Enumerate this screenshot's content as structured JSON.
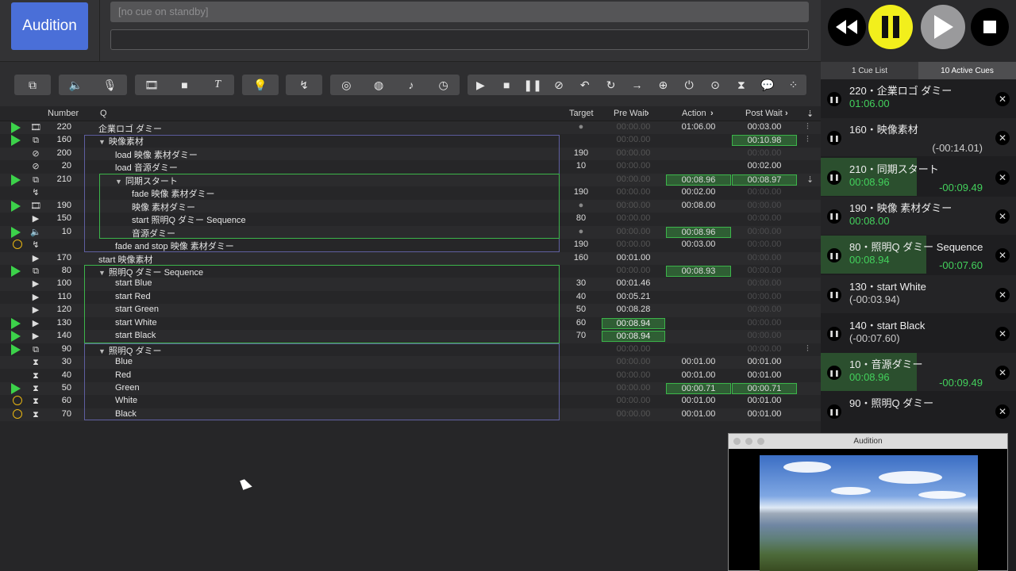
{
  "header": {
    "audition_label": "Audition",
    "standby_text": "[no cue on standby]",
    "notes_value": ""
  },
  "table": {
    "columns": [
      "Number",
      "Q",
      "Target",
      "Pre Wait",
      "Action",
      "Post Wait"
    ]
  },
  "rows": [
    {
      "flag": "play",
      "type": "video",
      "num": "220",
      "indent": 0,
      "tri": false,
      "name": "企業ロゴ ダミー",
      "target": "●",
      "pre": "00:00.00",
      "act": "01:06.00",
      "post": "00:03.00"
    },
    {
      "flag": "play",
      "type": "group",
      "num": "160",
      "indent": 0,
      "tri": true,
      "name": "映像素材",
      "target": "",
      "pre": "00:00.00",
      "act": "",
      "post": "00:10.98"
    },
    {
      "flag": "",
      "type": "load",
      "num": "200",
      "indent": 1,
      "tri": false,
      "name": "load 映像 素材ダミー",
      "target": "190",
      "pre": "00:00.00",
      "act": "",
      "post": "00:00.00"
    },
    {
      "flag": "",
      "type": "load",
      "num": "20",
      "indent": 1,
      "tri": false,
      "name": "load 音源ダミー",
      "target": "10",
      "pre": "00:00.00",
      "act": "",
      "post": "00:02.00"
    },
    {
      "flag": "play",
      "type": "group",
      "num": "210",
      "indent": 1,
      "tri": true,
      "name": "同期スタート",
      "target": "",
      "pre": "00:00.00",
      "act": "00:08.96",
      "post": "00:08.97"
    },
    {
      "flag": "",
      "type": "fade",
      "num": "",
      "indent": 2,
      "tri": false,
      "name": "fade 映像 素材ダミー",
      "target": "190",
      "pre": "00:00.00",
      "act": "00:02.00",
      "post": "00:00.00"
    },
    {
      "flag": "play",
      "type": "video",
      "num": "190",
      "indent": 2,
      "tri": false,
      "name": "映像 素材ダミー",
      "target": "●",
      "pre": "00:00.00",
      "act": "00:08.00",
      "post": "00:00.00"
    },
    {
      "flag": "",
      "type": "start",
      "num": "150",
      "indent": 2,
      "tri": false,
      "name": "start 照明Q ダミー Sequence",
      "target": "80",
      "pre": "00:00.00",
      "act": "",
      "post": "00:00.00"
    },
    {
      "flag": "play",
      "type": "audio",
      "num": "10",
      "indent": 2,
      "tri": false,
      "name": "音源ダミー",
      "target": "●",
      "pre": "00:00.00",
      "act": "00:08.96",
      "post": "00:00.00"
    },
    {
      "flag": "warn",
      "type": "fade",
      "num": "",
      "indent": 1,
      "tri": false,
      "name": "fade and stop 映像 素材ダミー",
      "target": "190",
      "pre": "00:00.00",
      "act": "00:03.00",
      "post": "00:00.00"
    },
    {
      "flag": "",
      "type": "start",
      "num": "170",
      "indent": 0,
      "tri": false,
      "name": "start 映像素材",
      "target": "160",
      "pre": "00:01.00",
      "act": "",
      "post": "00:00.00"
    },
    {
      "flag": "play",
      "type": "group",
      "num": "80",
      "indent": 0,
      "tri": true,
      "name": "照明Q ダミー Sequence",
      "target": "",
      "pre": "00:00.00",
      "act": "00:08.93",
      "post": "00:00.00"
    },
    {
      "flag": "",
      "type": "start",
      "num": "100",
      "indent": 1,
      "tri": false,
      "name": "start Blue",
      "target": "30",
      "pre": "00:01.46",
      "act": "",
      "post": "00:00.00"
    },
    {
      "flag": "",
      "type": "start",
      "num": "110",
      "indent": 1,
      "tri": false,
      "name": "start Red",
      "target": "40",
      "pre": "00:05.21",
      "act": "",
      "post": "00:00.00"
    },
    {
      "flag": "",
      "type": "start",
      "num": "120",
      "indent": 1,
      "tri": false,
      "name": "start Green",
      "target": "50",
      "pre": "00:08.28",
      "act": "",
      "post": "00:00.00"
    },
    {
      "flag": "play",
      "type": "start",
      "num": "130",
      "indent": 1,
      "tri": false,
      "name": "start White",
      "target": "60",
      "pre": "00:08.94",
      "act": "",
      "post": "00:00.00"
    },
    {
      "flag": "play",
      "type": "start",
      "num": "140",
      "indent": 1,
      "tri": false,
      "name": "start Black",
      "target": "70",
      "pre": "00:08.94",
      "act": "",
      "post": "00:00.00"
    },
    {
      "flag": "play",
      "type": "group",
      "num": "90",
      "indent": 0,
      "tri": true,
      "name": "照明Q ダミー",
      "target": "",
      "pre": "00:00.00",
      "act": "",
      "post": "00:00.00"
    },
    {
      "flag": "",
      "type": "wait",
      "num": "30",
      "indent": 1,
      "tri": false,
      "name": "Blue",
      "target": "",
      "pre": "00:00.00",
      "act": "00:01.00",
      "post": "00:01.00"
    },
    {
      "flag": "",
      "type": "wait",
      "num": "40",
      "indent": 1,
      "tri": false,
      "name": "Red",
      "target": "",
      "pre": "00:00.00",
      "act": "00:01.00",
      "post": "00:01.00"
    },
    {
      "flag": "play",
      "type": "wait",
      "num": "50",
      "indent": 1,
      "tri": false,
      "name": "Green",
      "target": "",
      "pre": "00:00.00",
      "act": "00:00.71",
      "post": "00:00.71"
    },
    {
      "flag": "warn",
      "type": "wait",
      "num": "60",
      "indent": 1,
      "tri": false,
      "name": "White",
      "target": "",
      "pre": "00:00.00",
      "act": "00:01.00",
      "post": "00:01.00"
    },
    {
      "flag": "warn",
      "type": "wait",
      "num": "70",
      "indent": 1,
      "tri": false,
      "name": "Black",
      "target": "",
      "pre": "00:00.00",
      "act": "00:01.00",
      "post": "00:01.00"
    }
  ],
  "active_panel": {
    "tab_cue_list": "1 Cue List",
    "tab_active": "10 Active Cues",
    "cues": [
      {
        "name": "220・企業ロゴ ダミー",
        "elapsed": "01:06.00",
        "remaining": "",
        "progress": 0
      },
      {
        "name": "160・映像素材",
        "elapsed": "",
        "remaining": "(-00:14.01)",
        "progress": 0
      },
      {
        "name": "210・同期スタート",
        "elapsed": "00:08.96",
        "remaining": "-00:09.49",
        "progress": 0.49
      },
      {
        "name": "190・映像 素材ダミー",
        "elapsed": "00:08.00",
        "remaining": "",
        "progress": 0
      },
      {
        "name": "80・照明Q ダミー Sequence",
        "elapsed": "00:08.94",
        "remaining": "-00:07.60",
        "progress": 0.54
      },
      {
        "name": "130・start White",
        "elapsed": "(-00:03.94)",
        "remaining": "",
        "progress": 0
      },
      {
        "name": "140・start Black",
        "elapsed": "(-00:07.60)",
        "remaining": "",
        "progress": 0
      },
      {
        "name": "10・音源ダミー",
        "elapsed": "00:08.96",
        "remaining": "-00:09.49",
        "progress": 0.49
      },
      {
        "name": "90・照明Q ダミー",
        "elapsed": "",
        "remaining": "",
        "progress": 0
      }
    ]
  },
  "audition_window": {
    "title": "Audition"
  }
}
